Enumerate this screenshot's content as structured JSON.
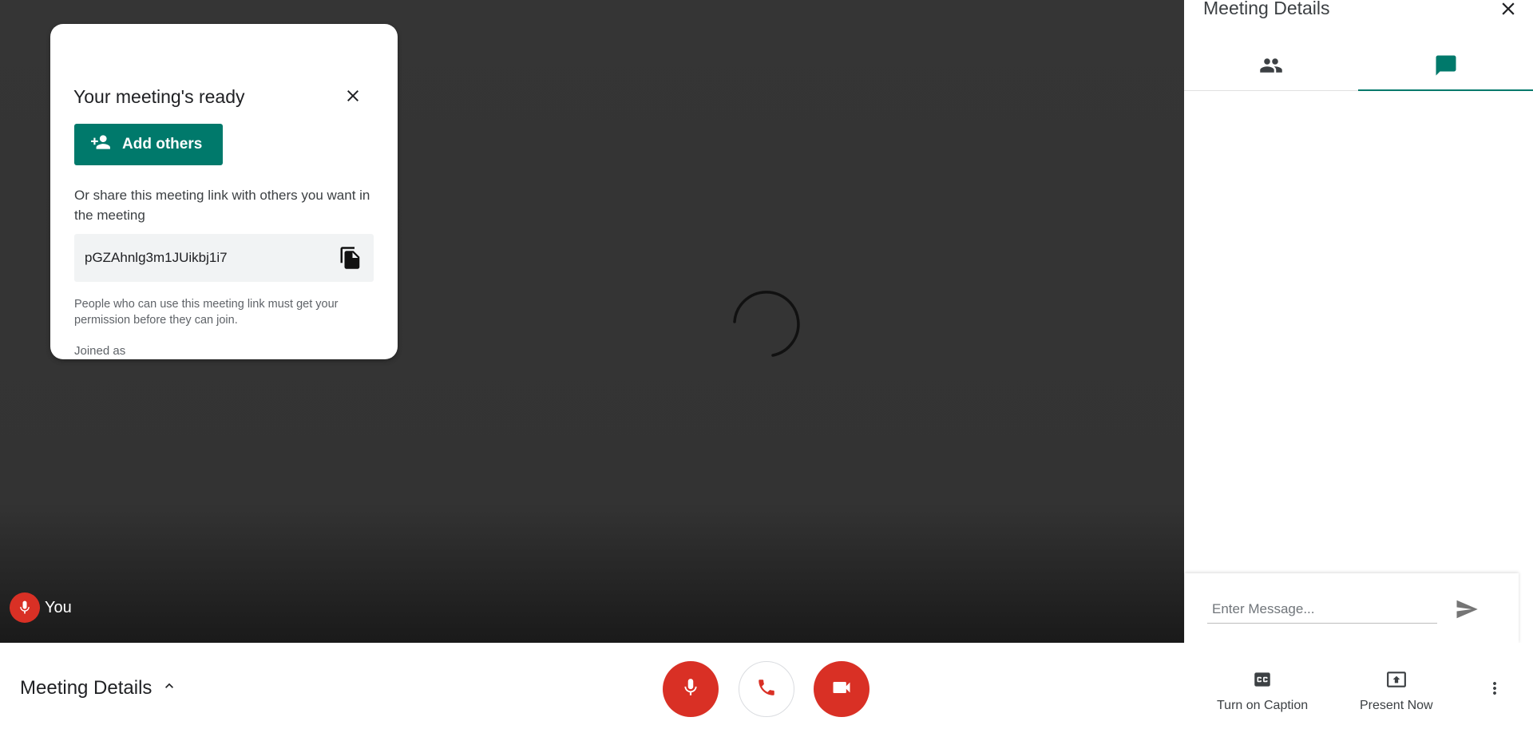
{
  "popup": {
    "title": "Your meeting's ready",
    "add_others_label": "Add others",
    "share_text": "Or share this meeting link with others you want in the meeting",
    "meeting_link": "pGZAhnlg3m1JUikbj1i7",
    "permission_text": "People who can use this meeting link must get your permission before they can join.",
    "joined_as_label": "Joined as"
  },
  "self_tile": {
    "name": "You"
  },
  "side_panel": {
    "title": "Meeting Details",
    "active_tab": "chat",
    "message_placeholder": "Enter Message..."
  },
  "bottom_bar": {
    "details_label": "Meeting Details",
    "caption_label": "Turn on Caption",
    "present_label": "Present Now"
  },
  "colors": {
    "accent": "#00796b",
    "danger": "#d93025",
    "stage": "#333333"
  }
}
